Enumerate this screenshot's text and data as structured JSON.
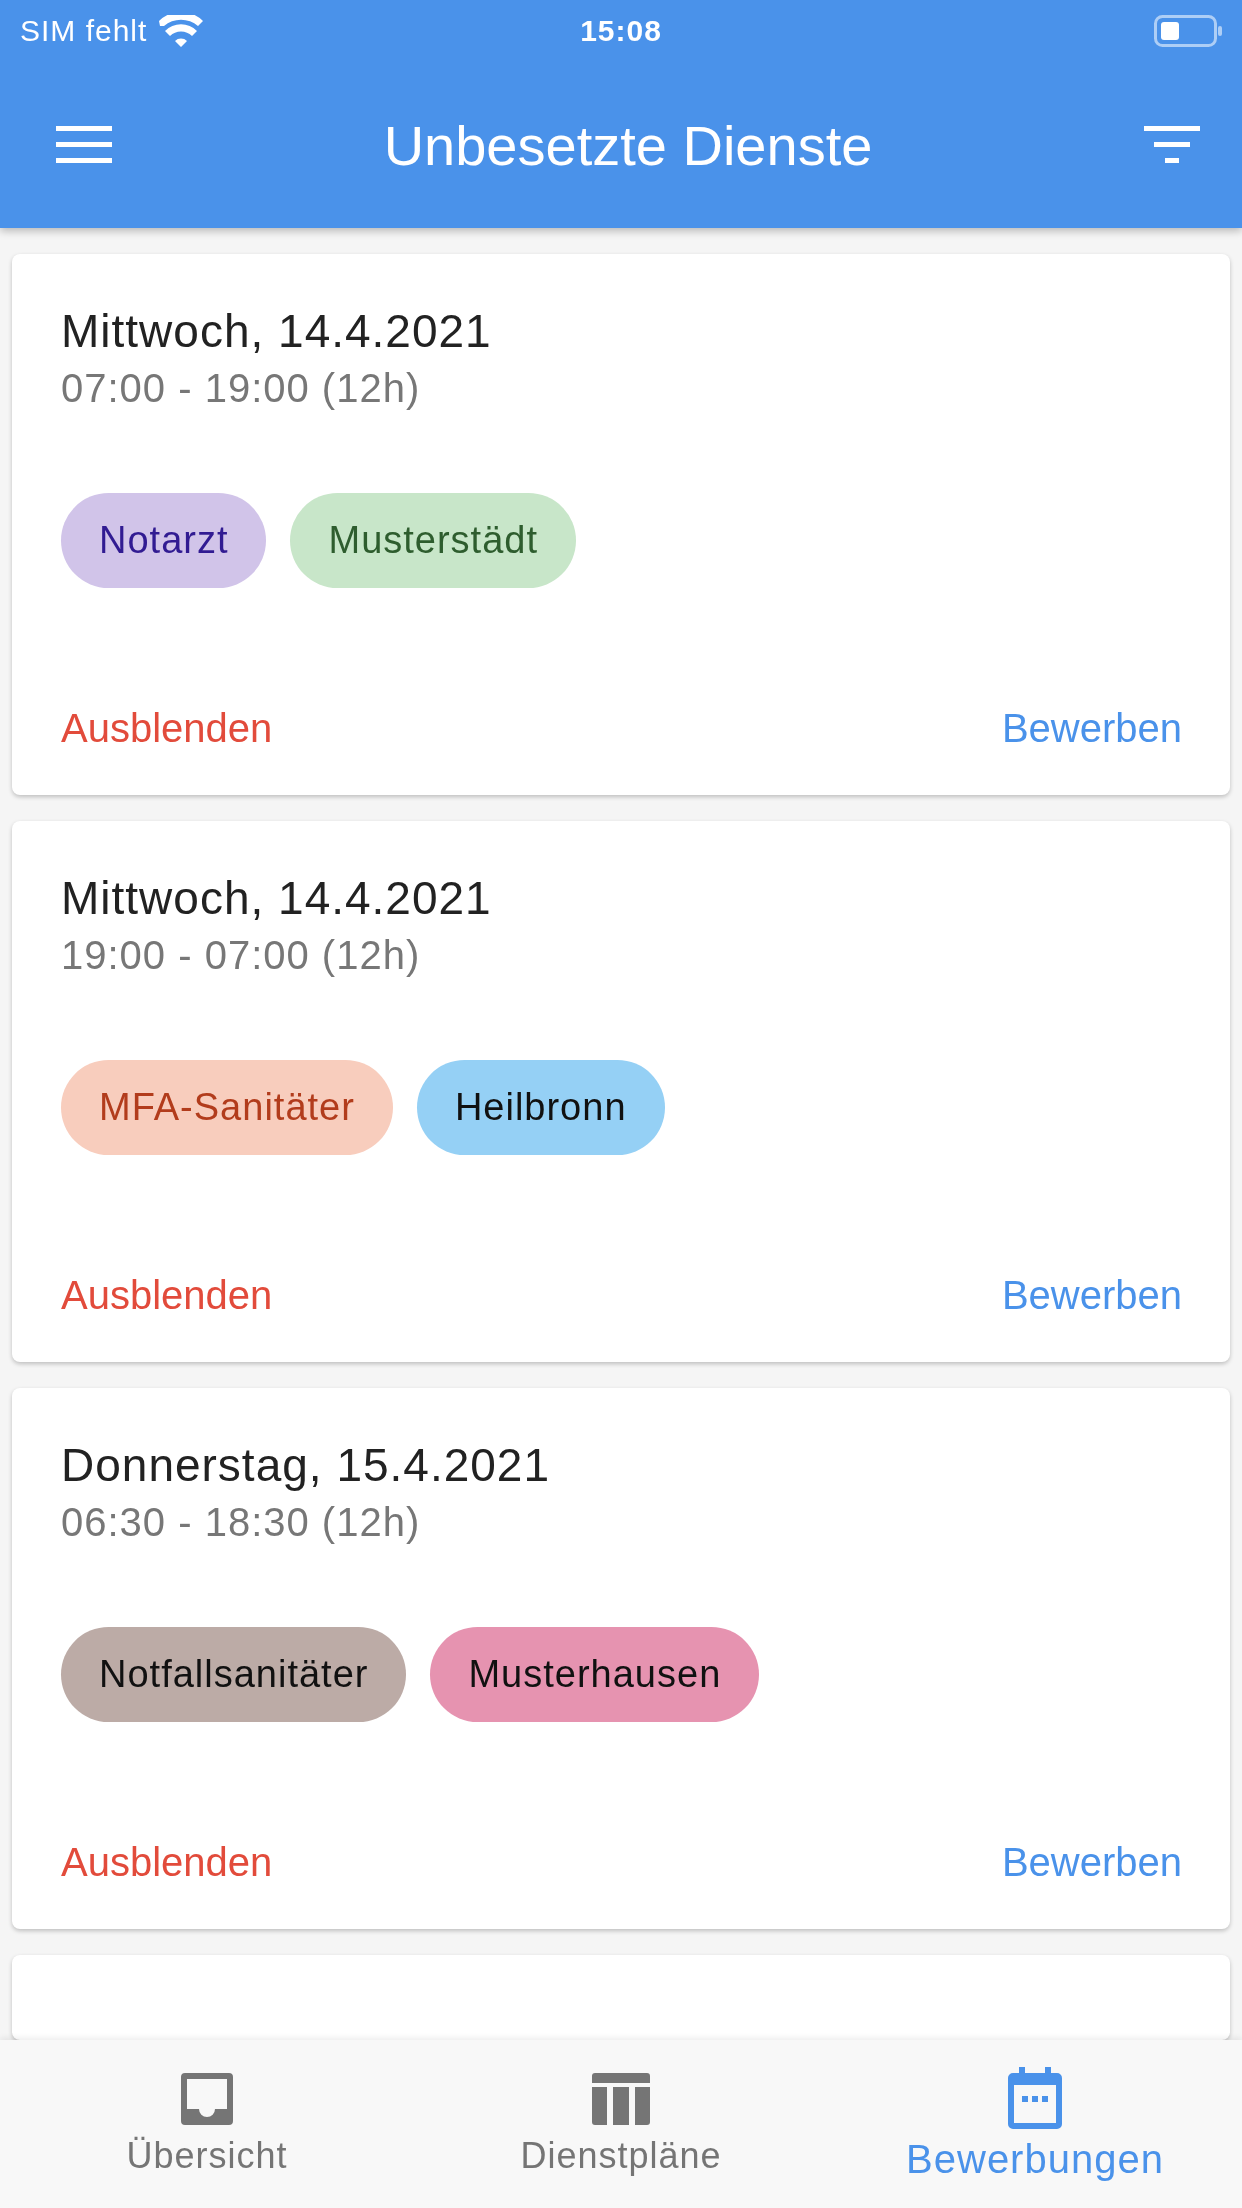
{
  "status_bar": {
    "carrier": "SIM fehlt",
    "time": "15:08"
  },
  "app_bar": {
    "title": "Unbesetzte Dienste"
  },
  "shifts": [
    {
      "date": "Mittwoch,  14.4.2021",
      "time": "07:00 - 19:00 (12h)",
      "tags": [
        {
          "label": "Notarzt",
          "color": "#d1c4e9"
        },
        {
          "label": "Musterstädt",
          "color": "#c8e6c9"
        }
      ],
      "hide": "Ausblenden",
      "apply": "Bewerben"
    },
    {
      "date": "Mittwoch,  14.4.2021",
      "time": "19:00 - 07:00 (12h)",
      "tags": [
        {
          "label": "MFA-Sanitäter",
          "color": "#f8cdbd"
        },
        {
          "label": "Heilbronn",
          "color": "#95d0f5"
        }
      ],
      "hide": "Ausblenden",
      "apply": "Bewerben"
    },
    {
      "date": "Donnerstag,  15.4.2021",
      "time": "06:30 - 18:30 (12h)",
      "tags": [
        {
          "label": "Notfallsanitäter",
          "color": "#bcaba6"
        },
        {
          "label": "Musterhausen",
          "color": "#e693b0"
        }
      ],
      "hide": "Ausblenden",
      "apply": "Bewerben"
    }
  ],
  "bottom_nav": [
    {
      "label": "Übersicht",
      "selected": false
    },
    {
      "label": "Dienstpläne",
      "selected": false
    },
    {
      "label": "Bewerbungen",
      "selected": true
    }
  ]
}
